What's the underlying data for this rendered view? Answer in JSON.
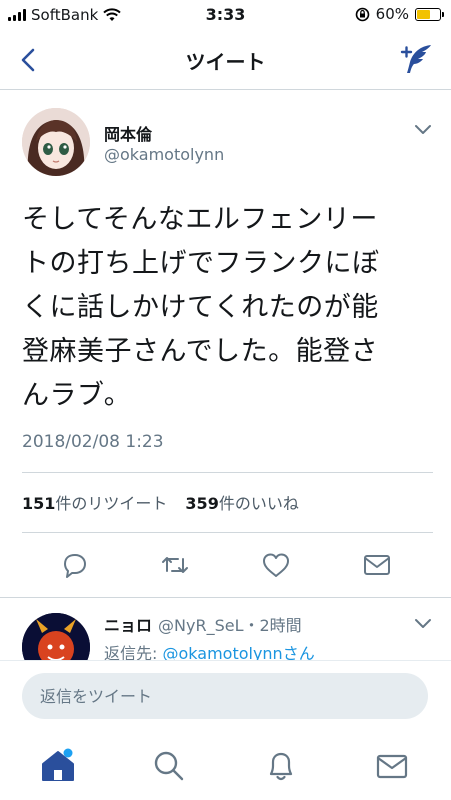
{
  "status_bar": {
    "carrier": "SoftBank",
    "time": "3:33",
    "battery": "60%",
    "battery_level": 0.6
  },
  "nav": {
    "title": "ツイート"
  },
  "tweet": {
    "author_name": "岡本倫",
    "author_handle": "@okamotolynn",
    "text_lines": [
      "そしてそんなエルフェンリー",
      "トの打ち上げでフランクにぼ",
      "くに話しかけてくれたのが能",
      "登麻美子さんでした。能登さ",
      "んラブ。"
    ],
    "date": "2018/02/08 1:23",
    "retweet_count": "151",
    "retweet_label": "件のリツイート",
    "like_count": "359",
    "like_label": "件のいいね"
  },
  "reply": {
    "name": "ニョロ",
    "handle_time": "@NyR_SeL・2時間",
    "reply_prefix": "返信先: ",
    "reply_to": "@okamotolynnさん"
  },
  "composer": {
    "placeholder": "返信をツイート"
  },
  "icons": {
    "accent": "#1da1f2",
    "nav_blue": "#2a4f9c",
    "icon_gray": "#657786"
  }
}
